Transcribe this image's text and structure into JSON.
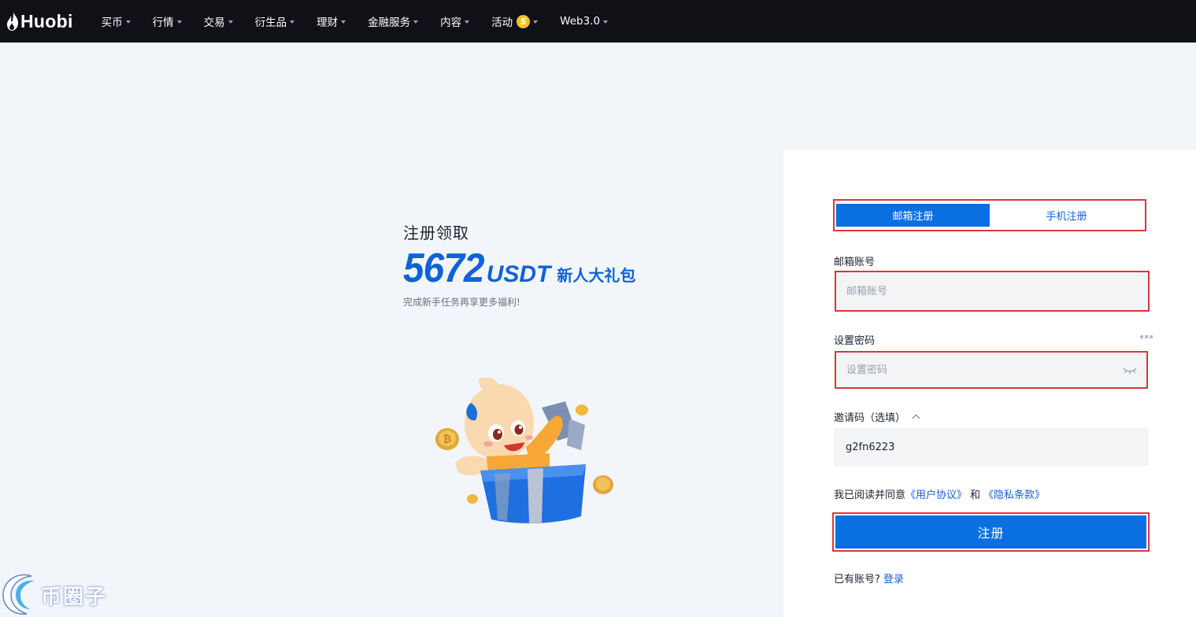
{
  "brand": {
    "name": "Huobi"
  },
  "nav": {
    "items": [
      {
        "label": "买币"
      },
      {
        "label": "行情"
      },
      {
        "label": "交易"
      },
      {
        "label": "衍生品"
      },
      {
        "label": "理财"
      },
      {
        "label": "金融服务"
      },
      {
        "label": "内容"
      },
      {
        "label": "活动",
        "badge": "S"
      },
      {
        "label": "Web3.0"
      }
    ]
  },
  "promo": {
    "title": "注册领取",
    "amount": "5672",
    "unit": "USDT",
    "gift": "新人大礼包",
    "subtitle": "完成新手任务再享更多福利!"
  },
  "form": {
    "tabs": [
      {
        "label": "邮箱注册",
        "active": true
      },
      {
        "label": "手机注册",
        "active": false
      }
    ],
    "email_label": "邮箱账号",
    "email_placeholder": "邮箱账号",
    "password_label": "设置密码",
    "password_placeholder": "设置密码",
    "invite_label": "邀请码（选填）",
    "invite_value": "g2fn6223",
    "agree_prefix": "我已阅读并同意",
    "user_agreement": "《用户协议》",
    "agree_and": "和",
    "privacy_policy": "《隐私条款》",
    "submit_label": "注册",
    "have_account": "已有账号?",
    "login_link": "登录"
  },
  "watermark": {
    "text": "币圈子"
  },
  "colors": {
    "accent": "#0a6fe1",
    "link": "#1062d6",
    "topbar": "#0f1117",
    "highlight_border": "#d9363e",
    "page_bg": "#f2f5fa"
  }
}
